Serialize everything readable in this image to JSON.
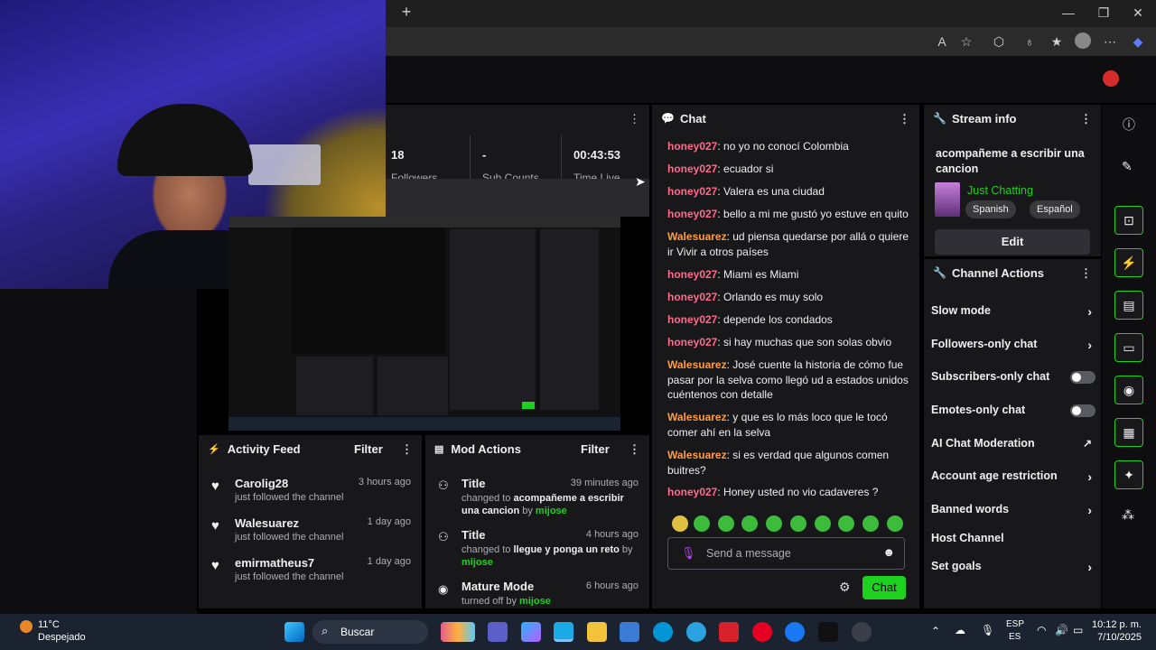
{
  "browser": {
    "new_tab_label": "+",
    "window_controls": [
      "—",
      "❐",
      "✕"
    ]
  },
  "stats": {
    "followers_value": "18",
    "followers_label": "Followers",
    "subs_value": "-",
    "subs_label": "Sub Counts",
    "time_value": "00:43:53",
    "time_label": "Time Live"
  },
  "chat": {
    "title": "Chat",
    "messages": [
      {
        "user": "honey027",
        "text": ": no yo no conocí Colombia",
        "color": "red"
      },
      {
        "user": "honey027",
        "text": ": ecuador si",
        "color": "red"
      },
      {
        "user": "honey027",
        "text": ": Valera es una ciudad",
        "color": "red"
      },
      {
        "user": "honey027",
        "text": ": bello a mi me gustó yo estuve en quito",
        "color": "red"
      },
      {
        "user": "Walesuarez",
        "text": ": ud piensa quedarse por allá o quiere ir Vivir a otros países",
        "color": "orange"
      },
      {
        "user": "honey027",
        "text": ": Miami es Miami",
        "color": "red"
      },
      {
        "user": "honey027",
        "text": ": Orlando es muy solo",
        "color": "red"
      },
      {
        "user": "honey027",
        "text": ": depende los condados",
        "color": "red"
      },
      {
        "user": "honey027",
        "text": ": si hay muchas que son solas obvio",
        "color": "red"
      },
      {
        "user": "Walesuarez",
        "text": ": José cuente la historia de cómo fue pasar por la selva como llegó ud a estados unidos cuéntenos con detalle",
        "color": "orange"
      },
      {
        "user": "Walesuarez",
        "text": ": y que es lo más loco que le tocó comer ahí en la selva",
        "color": "orange"
      },
      {
        "user": "Walesuarez",
        "text": ": si es verdad que algunos comen buitres?",
        "color": "orange"
      },
      {
        "user": "honey027",
        "text": ": Honey usted no vio cadaveres ?",
        "color": "red"
      }
    ],
    "input_placeholder": "Send a message",
    "send_label": "Chat"
  },
  "stream_info": {
    "title": "Stream info",
    "stream_title": "acompañeme a escribir una cancion",
    "category": "Just Chatting",
    "tags": [
      "Spanish",
      "Español"
    ],
    "edit_label": "Edit"
  },
  "channel_actions": {
    "title": "Channel Actions",
    "items": [
      {
        "label": "Slow mode",
        "control": "arrow"
      },
      {
        "label": "Followers-only chat",
        "control": "arrow"
      },
      {
        "label": "Subscribers-only chat",
        "control": "toggle"
      },
      {
        "label": "Emotes-only chat",
        "control": "toggle"
      },
      {
        "label": "AI Chat Moderation",
        "control": "external"
      },
      {
        "label": "Account age restriction",
        "control": "arrow"
      },
      {
        "label": "Banned words",
        "control": "arrow"
      },
      {
        "label": "Host Channel",
        "control": "none"
      },
      {
        "label": "Set goals",
        "control": "arrow"
      }
    ]
  },
  "activity_feed": {
    "title": "Activity Feed",
    "filter_label": "Filter",
    "items": [
      {
        "name": "Carolig28",
        "action": "just followed the channel",
        "time": "3 hours ago"
      },
      {
        "name": "Walesuarez",
        "action": "just followed the channel",
        "time": "1 day ago"
      },
      {
        "name": "emirmatheus7",
        "action": "just followed the channel",
        "time": "1 day ago"
      }
    ]
  },
  "mod_actions": {
    "title": "Mod Actions",
    "filter_label": "Filter",
    "items": [
      {
        "title": "Title",
        "prefix": "changed to ",
        "value": "acompañeme a escribir una cancion",
        "by_text": " by ",
        "by": "mijose",
        "time": "39 minutes ago"
      },
      {
        "title": "Title",
        "prefix": "changed to ",
        "value": "llegue y ponga un reto",
        "by_text": " by ",
        "by": "mijose",
        "time": "4 hours ago"
      },
      {
        "title": "Mature Mode",
        "prefix": "turned off by ",
        "value": "",
        "by_text": "",
        "by": "mijose",
        "time": "6 hours ago"
      }
    ]
  },
  "taskbar": {
    "weather_temp": "11°C",
    "weather_desc": "Despejado",
    "search_placeholder": "Buscar",
    "lang_top": "ESP",
    "lang_bottom": "ES",
    "clock_time": "10:12 p. m.",
    "clock_date": "7/10/2025"
  },
  "colors": {
    "accent": "#1fd11f",
    "user_red": "#ff6b8b",
    "user_orange": "#ff9d3c",
    "panel": "#18181b"
  }
}
